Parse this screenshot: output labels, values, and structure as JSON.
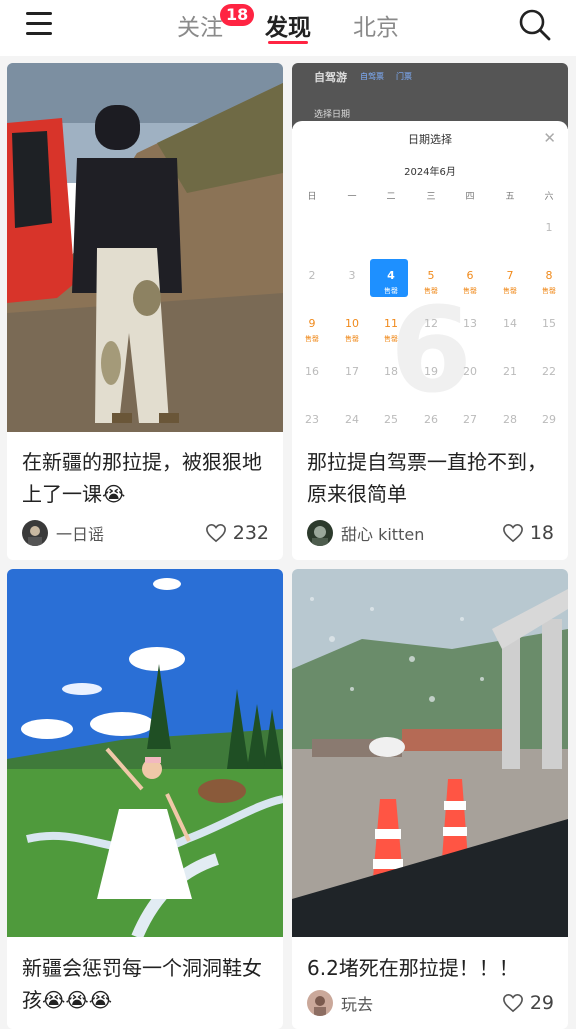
{
  "header": {
    "tabs": [
      {
        "label": "关注",
        "badge": "18"
      },
      {
        "label": "发现",
        "active": true
      },
      {
        "label": "北京"
      }
    ],
    "menu_icon": "hamburger-icon",
    "search_icon": "search-icon",
    "accent_color": "#ff2442"
  },
  "posts": [
    {
      "title": "在新疆的那拉提，被狠狠地上了一课😭",
      "author": "一日谣",
      "likes": "232",
      "cover": "muddy-pants-photo"
    },
    {
      "title": "那拉提自驾票一直抢不到，原来很简单",
      "author": "甜心 kitten",
      "likes": "18",
      "cover": "calendar-screenshot"
    },
    {
      "title": "新疆会惩罚每一个洞洞鞋女孩😭😭😭",
      "author": "",
      "likes": "",
      "cover": "meadow-photo"
    },
    {
      "title": "6.2堵死在那拉提！！！",
      "author": "玩去",
      "likes": "29",
      "cover": "rainy-window-photo"
    }
  ],
  "calendar_shot": {
    "app_header": "自驾游",
    "app_tabs": [
      "自驾票",
      "门票"
    ],
    "select_label": "选择日期",
    "dialog_title": "日期选择",
    "month": "2024年6月",
    "weekdays": [
      "日",
      "一",
      "二",
      "三",
      "四",
      "五",
      "六"
    ],
    "sold_label": "售罄",
    "big_digit": "6",
    "rows": [
      [
        "",
        "",
        "",
        "",
        "",
        "",
        "1"
      ],
      [
        "2",
        "3",
        "4",
        "5",
        "6",
        "7",
        "8"
      ],
      [
        "9",
        "10",
        "11",
        "12",
        "13",
        "14",
        "15"
      ],
      [
        "16",
        "17",
        "18",
        "19",
        "20",
        "21",
        "22"
      ],
      [
        "23",
        "24",
        "25",
        "26",
        "27",
        "28",
        "29"
      ]
    ]
  }
}
